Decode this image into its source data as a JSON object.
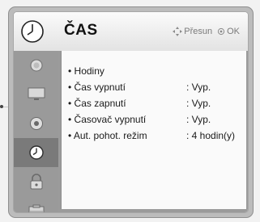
{
  "header": {
    "title": "ČAS",
    "hint": {
      "move_label": "Přesun",
      "ok_label": "OK"
    }
  },
  "sidebar": {
    "items": [
      {
        "icon": "picture-icon"
      },
      {
        "icon": "screen-icon"
      },
      {
        "icon": "audio-icon"
      },
      {
        "icon": "clock-icon",
        "active": true
      },
      {
        "icon": "lock-icon"
      },
      {
        "icon": "options-icon"
      }
    ]
  },
  "menu": {
    "items": [
      {
        "label": "Hodiny",
        "value": ""
      },
      {
        "label": "Čas vypnutí",
        "value": ": Vyp."
      },
      {
        "label": "Čas zapnutí",
        "value": ": Vyp."
      },
      {
        "label": "Časovač vypnutí",
        "value": ": Vyp."
      },
      {
        "label": "Aut. pohot. režim",
        "value": ": 4 hodin(y)"
      }
    ]
  },
  "colors": {
    "active_tab": "#7a7a7a",
    "panel": "#bcbcbc"
  }
}
